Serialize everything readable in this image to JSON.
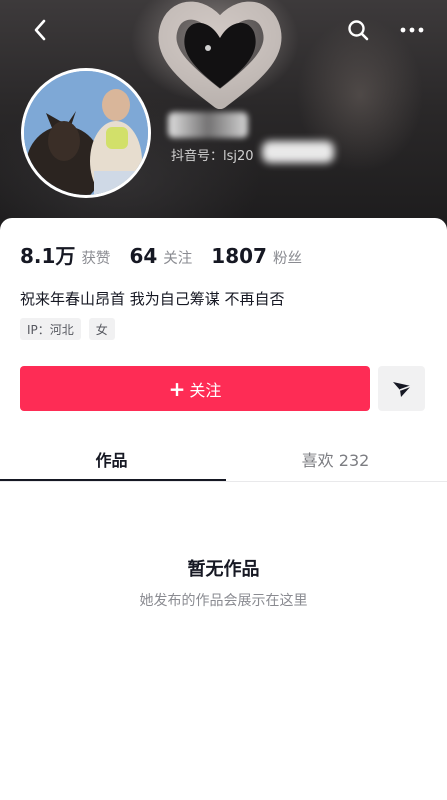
{
  "header": {
    "back_icon": "chevron-left-icon",
    "search_icon": "search-icon",
    "more_icon": "more-horizontal-icon"
  },
  "profile": {
    "nickname": "",
    "douyin_id": "抖音号：lsj20",
    "stats": [
      {
        "value": "8.1万",
        "label": "获赞"
      },
      {
        "value": "64",
        "label": "关注"
      },
      {
        "value": "1807",
        "label": "粉丝"
      }
    ],
    "bio": "祝来年春山昂首  我为自己筹谋  不再自否",
    "tags": [
      "IP：河北",
      "女"
    ]
  },
  "actions": {
    "follow_label": "关注",
    "follow_color": "#fe2c55",
    "share_icon": "send-icon"
  },
  "tabs": [
    {
      "label": "作品",
      "active": true
    },
    {
      "label": "喜欢 232",
      "active": false
    }
  ],
  "empty_state": {
    "title": "暂无作品",
    "subtitle": "她发布的作品会展示在这里"
  }
}
